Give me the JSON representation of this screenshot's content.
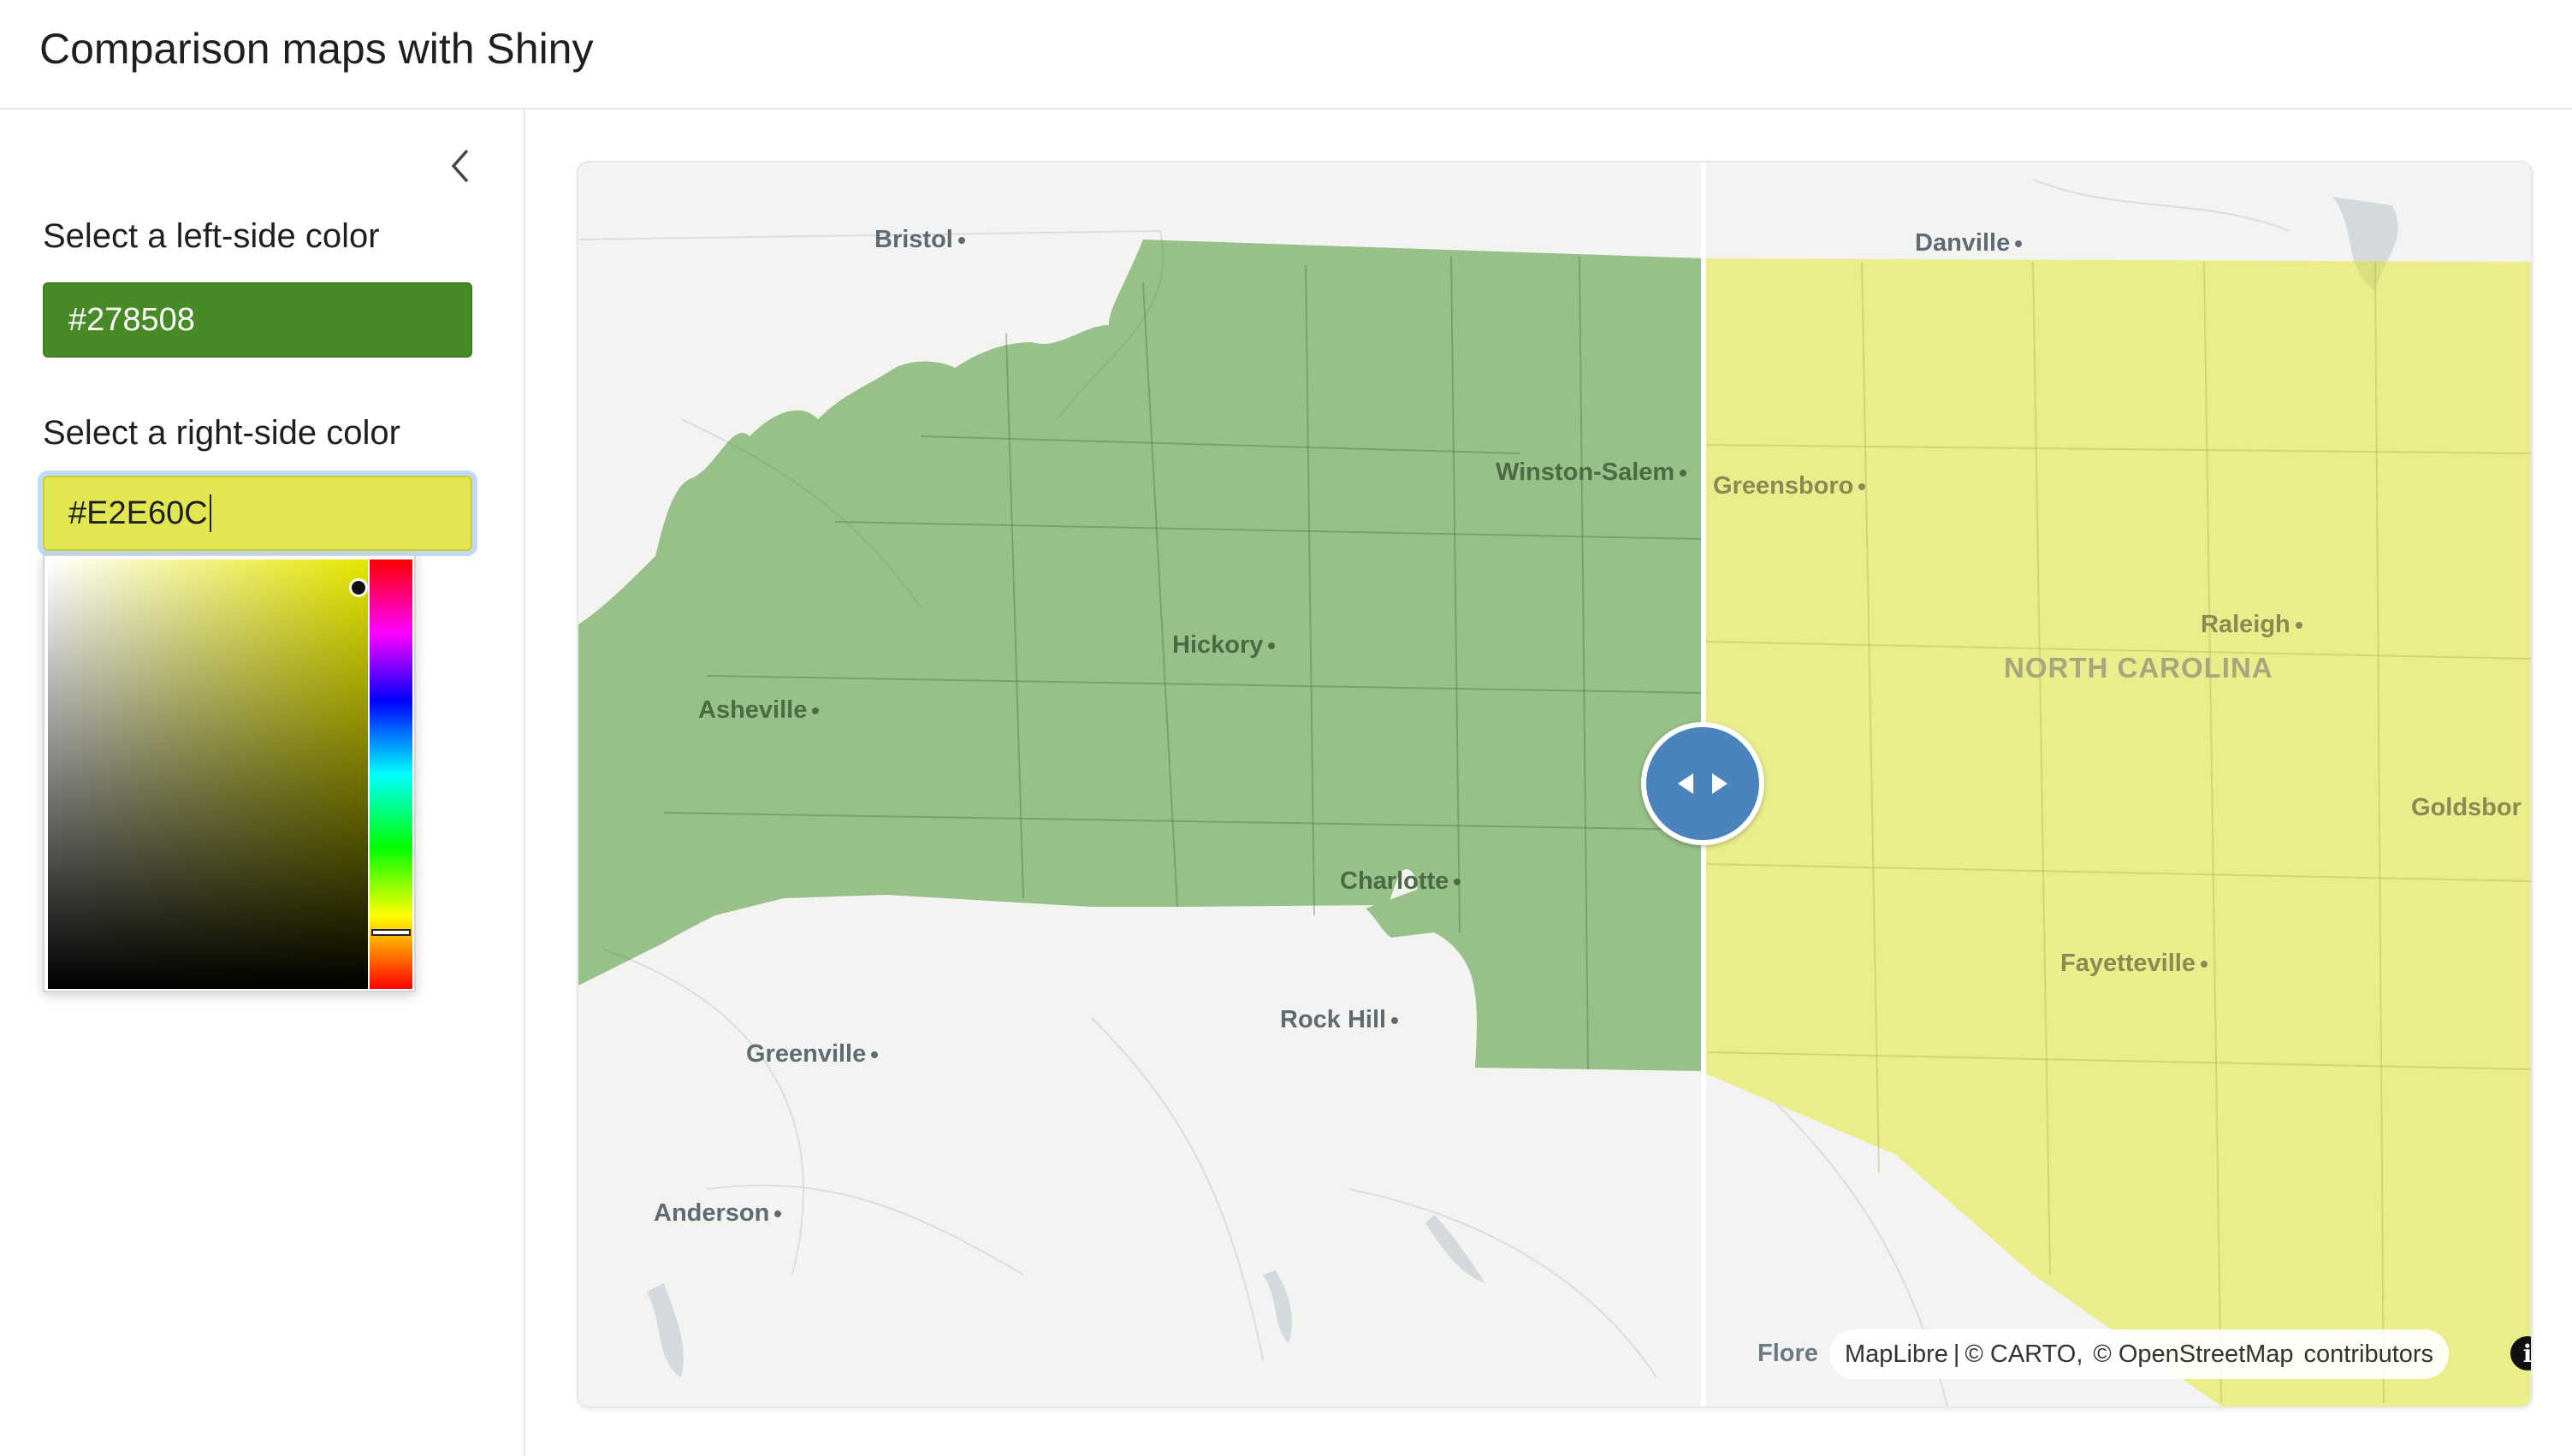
{
  "app": {
    "title": "Comparison maps with Shiny"
  },
  "sidebar": {
    "collapse_icon": "chevron-left-icon",
    "left_color_label": "Select a left-side color",
    "left_color_value": "#278508",
    "right_color_label": "Select a right-side color",
    "right_color_value": "#E2E60C"
  },
  "colors": {
    "left_fill": "#278508",
    "right_fill": "#E2E60C",
    "swipe_handle": "#4a83be"
  },
  "map": {
    "cities": [
      {
        "name": "Bristol"
      },
      {
        "name": "Danville"
      },
      {
        "name": "Winston-Salem"
      },
      {
        "name": "Greensboro"
      },
      {
        "name": "Raleigh"
      },
      {
        "name": "Hickory"
      },
      {
        "name": "Asheville"
      },
      {
        "name": "Goldsbor"
      },
      {
        "name": "Charlotte"
      },
      {
        "name": "Fayetteville"
      },
      {
        "name": "Rock Hill"
      },
      {
        "name": "Greenville"
      },
      {
        "name": "Anderson"
      }
    ],
    "state_label": "NORTH CAROLINA",
    "partial_label": "Flore",
    "attribution": {
      "maplibre": "MapLibre",
      "separator": "|",
      "carto": "© CARTO,",
      "osm": "© OpenStreetMap",
      "contributors": "contributors"
    },
    "info_icon": "i"
  }
}
